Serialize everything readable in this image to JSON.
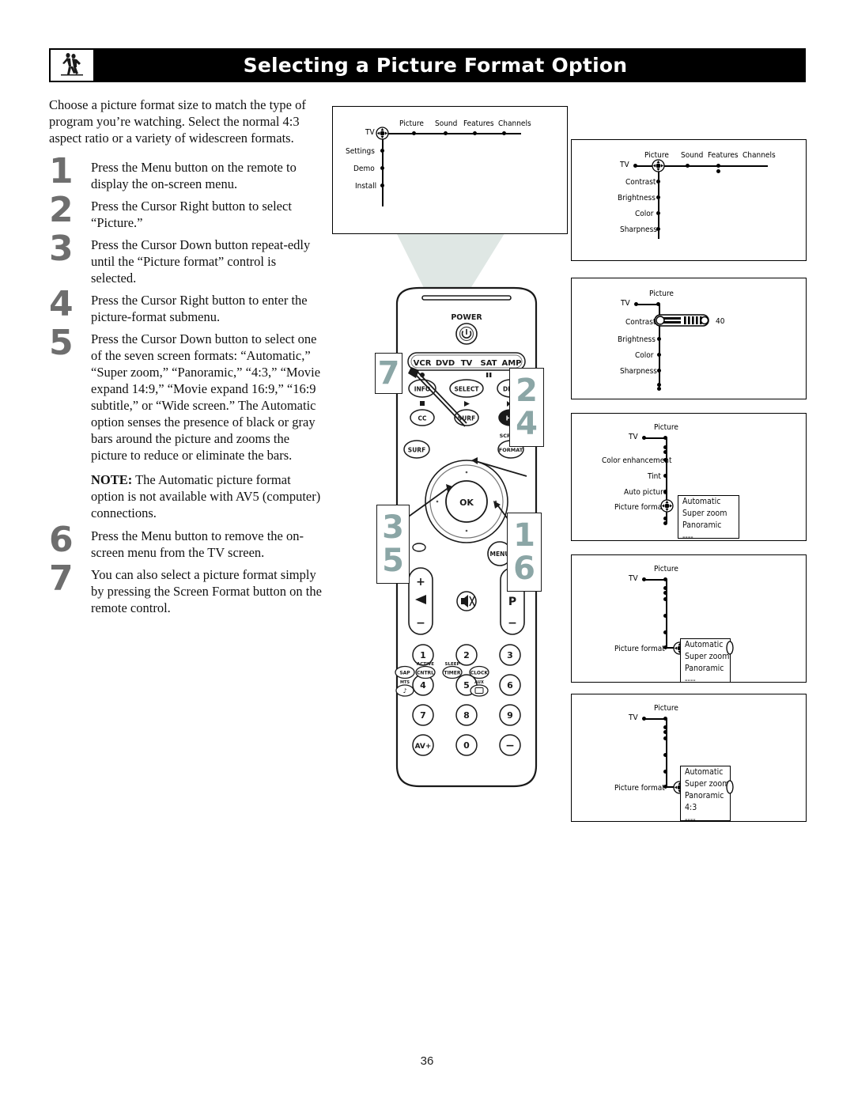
{
  "header": {
    "title": "Selecting a Picture Format Option",
    "logo_icon": "two-dancers-logo"
  },
  "intro": "Choose a picture format size to match the type of program you’re watching. Select the normal 4:3 aspect ratio or a variety of widescreen formats.",
  "steps": [
    {
      "num": "1",
      "text": "Press the Menu button on the remote to display the on-screen menu."
    },
    {
      "num": "2",
      "text": "Press the Cursor Right button to select “Picture.”"
    },
    {
      "num": "3",
      "text": "Press the Cursor Down button repeat-edly until the “Picture format” control is selected."
    },
    {
      "num": "4",
      "text": "Press the Cursor Right button to enter the picture-format submenu."
    },
    {
      "num": "5",
      "text": "Press the Cursor Down button to select one of the seven screen formats: “Automatic,” “Super zoom,” “Panoramic,” “4:3,” “Movie expand 14:9,” “Movie expand 16:9,” “16:9 subtitle,” or “Wide screen.” The Automatic option senses the presence of black or gray bars around the picture and zooms the picture to reduce or eliminate the bars."
    },
    {
      "num": "6",
      "text": "Press the Menu button to remove the on-screen menu from the TV screen."
    },
    {
      "num": "7",
      "text": "You can also select a picture format simply by pressing the Screen Format button on the remote control."
    }
  ],
  "note": {
    "label": "NOTE:",
    "text": " The Automatic picture format option is not available with AV5 (computer) connections."
  },
  "tv_screen": {
    "root_label": "TV",
    "top_items": [
      "Picture",
      "Sound",
      "Features",
      "Channels"
    ],
    "side_items": [
      "Settings",
      "Demo",
      "Install"
    ]
  },
  "panels": [
    {
      "id": "panel-picture-highlighted",
      "root_label": "TV",
      "top_items": [
        "Picture",
        "Sound",
        "Features",
        "Channels"
      ],
      "side_items": [
        "Contrast",
        "Brightness",
        "Color",
        "Sharpness"
      ],
      "cursor_on": "Picture"
    },
    {
      "id": "panel-contrast-slider",
      "root_label": "TV",
      "column_label": "Picture",
      "side_items": [
        "Contrast",
        "Brightness",
        "Color",
        "Sharpness"
      ],
      "slider_item": "Contrast",
      "slider_value": "40"
    },
    {
      "id": "panel-picture-format-selected",
      "root_label": "TV",
      "column_label": "Picture",
      "side_items": [
        "Color enhancement",
        "Tint",
        "Auto picture",
        "Picture format"
      ],
      "cursor_on": "Picture format",
      "options": [
        "Automatic",
        "Super zoom",
        "Panoramic",
        "----"
      ]
    },
    {
      "id": "panel-submenu-automatic",
      "root_label": "TV",
      "column_label": "Picture",
      "side_items": [
        "Picture format"
      ],
      "options": [
        "Automatic",
        "Super zoom",
        "Panoramic",
        "----"
      ],
      "selected_option": "Automatic"
    },
    {
      "id": "panel-submenu-superzoom",
      "root_label": "TV",
      "column_label": "Picture",
      "side_items": [
        "Picture format"
      ],
      "options": [
        "Automatic",
        "Super zoom",
        "Panoramic",
        "4:3",
        "----"
      ],
      "selected_option": "Super zoom"
    }
  ],
  "remote": {
    "power_label": "POWER",
    "device_buttons": [
      "VCR",
      "DVD",
      "TV",
      "SAT",
      "AMP"
    ],
    "row_info": [
      "INFO",
      "SELECT",
      "DNM"
    ],
    "row_media": [
      "CC",
      "SURF",
      "HD"
    ],
    "screen_format_label_top": "SCREEN",
    "screen_format_label_bottom": "FORMAT",
    "surf_label": "SURF",
    "ok_label": "OK",
    "menu_label": "MENU",
    "volume_plus": "+",
    "volume_minus": "–",
    "program_label": "P",
    "program_plus": "+",
    "program_minus": "–",
    "mute_icon": "mute-icon",
    "keypad": [
      "1",
      "2",
      "3",
      "4",
      "5",
      "6",
      "7",
      "8",
      "9",
      "AV+",
      "0",
      "–"
    ],
    "bottom_row": [
      {
        "label": "SAP",
        "top": ""
      },
      {
        "label": "CNTRL",
        "top": "ACTIVE"
      },
      {
        "label": "TIMER",
        "top": "SLEEP"
      },
      {
        "label": "CLOCK",
        "top": ""
      }
    ],
    "bottom_row2": [
      {
        "label": "music-icon",
        "top": "MTS"
      },
      {
        "label": "screen-icon",
        "top": "AUX"
      }
    ]
  },
  "callouts": [
    {
      "id": "callout-7",
      "numbers": [
        "7"
      ]
    },
    {
      "id": "callout-2-4",
      "numbers": [
        "2",
        "4"
      ]
    },
    {
      "id": "callout-3-5",
      "numbers": [
        "3",
        "5"
      ]
    },
    {
      "id": "callout-1-6",
      "numbers": [
        "1",
        "6"
      ]
    }
  ],
  "colors": {
    "callout_number": "#8ba6a6",
    "step_number": "#6e6e6e",
    "beam": "#dfe7e4",
    "header_bg": "#000000"
  },
  "footer": {
    "page_number": "36"
  }
}
